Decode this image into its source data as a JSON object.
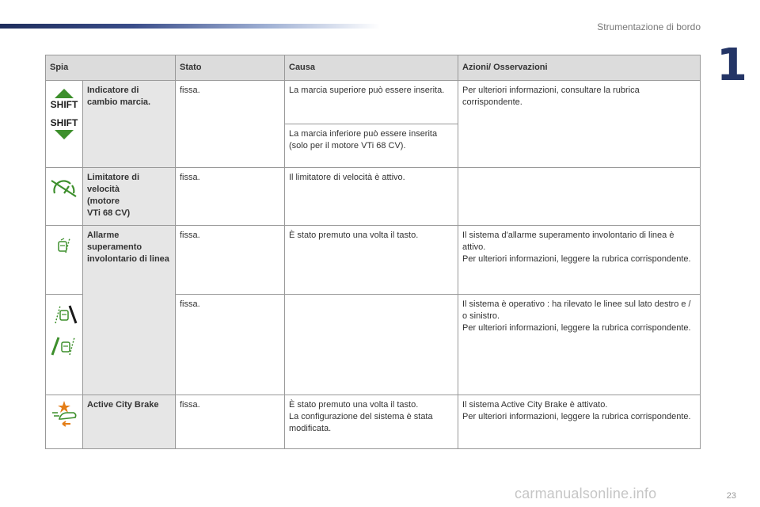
{
  "header": {
    "section_title": "Strumentazione di bordo",
    "chapter_number": "1",
    "page_number": "23"
  },
  "watermark": "carmanualsonline.info",
  "table": {
    "headers": [
      "Spia",
      "Stato",
      "Causa",
      "Azioni/ Osservazioni"
    ],
    "rows": [
      {
        "name": "Indicatore di cambio marcia.",
        "stato": "fissa.",
        "causa1": "La marcia superiore può essere inserita.",
        "causa2": "La marcia inferiore può essere inserita (solo per il motore VTi 68 CV).",
        "azioni": "Per ulteriori informazioni, consultare la rubrica corrispondente.",
        "icon_top": "shift-up-icon",
        "icon_bottom": "shift-down-icon",
        "icon_text": "SHIFT"
      },
      {
        "name_lines": [
          "Limitatore di",
          "velocità",
          "(motore",
          "VTi 68 CV)"
        ],
        "stato": "fissa.",
        "causa": "Il limitatore di velocità è attivo.",
        "azioni": "",
        "icon": "speed-limiter-icon"
      },
      {
        "name": "Allarme superamento involontario di linea",
        "stato": "fissa.",
        "causa": "È stato premuto una volta il tasto.",
        "azioni_lines": [
          "Il sistema d'allarme superamento involontario di linea è attivo.",
          "Per ulteriori informazioni, leggere la rubrica corrispondente."
        ],
        "icon": "lane-departure-icon"
      },
      {
        "stato": "fissa.",
        "azioni_lines": [
          "Il sistema è operativo : ha rilevato le linee sul lato destro e / o sinistro.",
          "Per ulteriori informazioni, leggere la rubrica corrispondente."
        ],
        "icon_top": "lane-right-detected-icon",
        "icon_bottom": "lane-left-detected-icon"
      },
      {
        "name": "Active City Brake",
        "stato": "fissa.",
        "causa_lines": [
          "È stato premuto una volta il tasto.",
          "La configurazione del sistema è stata modificata."
        ],
        "azioni_lines": [
          "Il sistema Active City Brake è attivato.",
          "Per ulteriori informazioni, leggere la rubrica corrispondente."
        ],
        "icon": "active-city-brake-icon"
      }
    ]
  },
  "colors": {
    "green_icon": "#3d8f2c",
    "orange_icon": "#e47d16",
    "header_bg": "#dcdcdc",
    "name_bg": "#e6e6e6",
    "chapter": "#243566"
  }
}
